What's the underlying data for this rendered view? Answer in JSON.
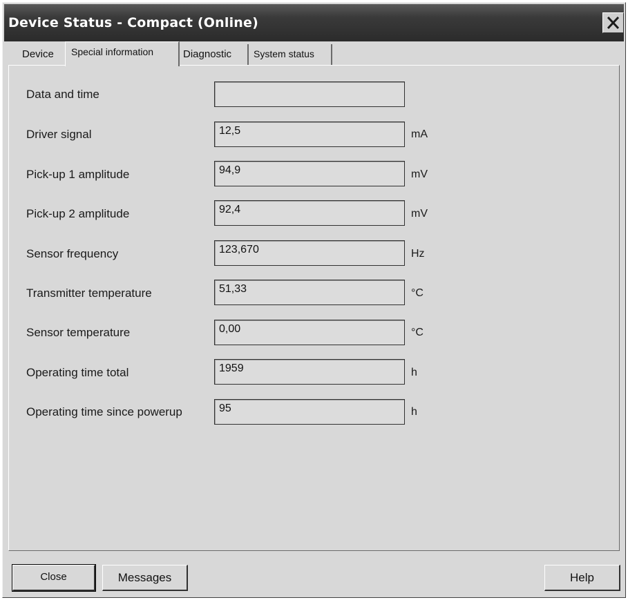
{
  "window": {
    "title": "Device Status - Compact  (Online)",
    "close_icon": "close-x-icon"
  },
  "tabs": [
    {
      "label": "Device",
      "active": false
    },
    {
      "label": "Special information",
      "active": true
    },
    {
      "label": "Diagnostic",
      "active": false
    },
    {
      "label": "System status",
      "active": false
    }
  ],
  "fields": [
    {
      "label": "Data and time",
      "value": "",
      "unit": ""
    },
    {
      "label": "Driver signal",
      "value": "12,5",
      "unit": "mA"
    },
    {
      "label": "Pick-up 1 amplitude",
      "value": "94,9",
      "unit": "mV"
    },
    {
      "label": "Pick-up 2 amplitude",
      "value": "92,4",
      "unit": "mV"
    },
    {
      "label": "Sensor frequency",
      "value": "123,670",
      "unit": "Hz"
    },
    {
      "label": "Transmitter temperature",
      "value": "51,33",
      "unit": "°C"
    },
    {
      "label": "Sensor temperature",
      "value": "0,00",
      "unit": "°C"
    },
    {
      "label": "Operating time total",
      "value": "1959",
      "unit": "h"
    },
    {
      "label": "Operating time since powerup",
      "value": "95",
      "unit": "h"
    }
  ],
  "buttons": {
    "close": "Close",
    "messages": "Messages",
    "help": "Help"
  }
}
